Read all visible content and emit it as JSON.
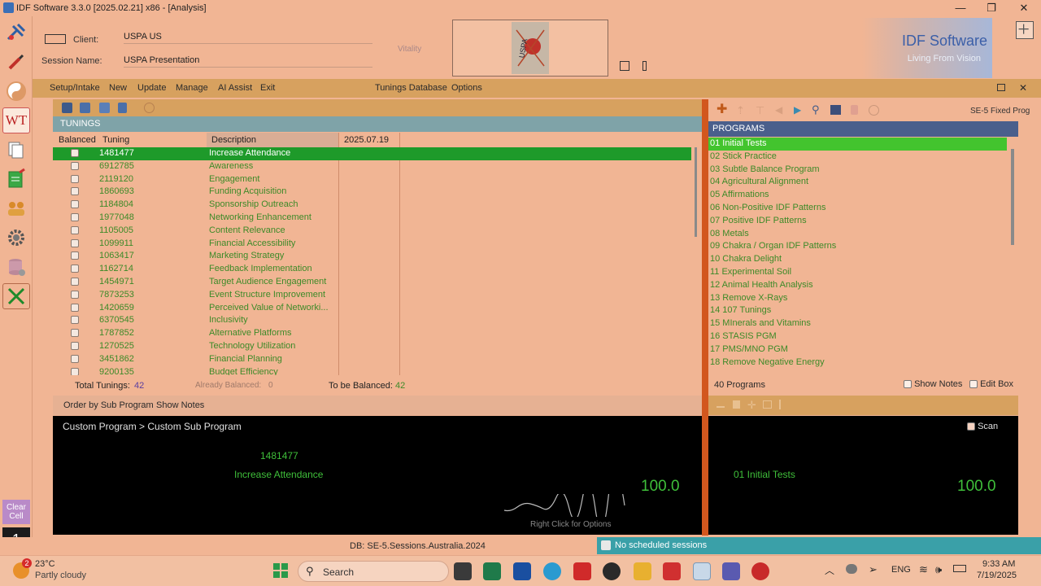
{
  "window": {
    "title": "IDF Software 3.3.0     [2025.02.21]  x86 - [Analysis]",
    "minimize": "—",
    "maximize": "❐",
    "close": "✕"
  },
  "header": {
    "client_label": "Client:",
    "client_value": "USPA US",
    "session_label": "Session Name:",
    "session_value": "USPA Presentation",
    "vitality_label": "Vitality",
    "brand_title": "IDF Software",
    "brand_tagline": "Living From Vision"
  },
  "menu": {
    "setup": "Setup/Intake",
    "new": "New",
    "update": "Update",
    "manage": "Manage",
    "ai_assist": "AI Assist",
    "exit": "Exit",
    "tunings_db": "Tunings Database",
    "options": "Options"
  },
  "tunings": {
    "title": "TUNINGS",
    "col_balanced": "Balanced",
    "col_tuning": "Tuning",
    "col_description": "Description",
    "col_date": "2025.07.19",
    "rows": [
      {
        "tuning": "1481477",
        "description": "Increase Attendance"
      },
      {
        "tuning": "6912785",
        "description": "Awareness"
      },
      {
        "tuning": "2119120",
        "description": "Engagement"
      },
      {
        "tuning": "1860693",
        "description": "Funding Acquisition"
      },
      {
        "tuning": "1184804",
        "description": "Sponsorship Outreach"
      },
      {
        "tuning": "1977048",
        "description": "Networking Enhancement"
      },
      {
        "tuning": "1105005",
        "description": "Content Relevance"
      },
      {
        "tuning": "1099911",
        "description": "Financial Accessibility"
      },
      {
        "tuning": "1063417",
        "description": "Marketing Strategy"
      },
      {
        "tuning": "1162714",
        "description": "Feedback Implementation"
      },
      {
        "tuning": "1454971",
        "description": "Target Audience Engagement"
      },
      {
        "tuning": "7873253",
        "description": "Event Structure Improvement"
      },
      {
        "tuning": "1420659",
        "description": "Perceived Value of Networki..."
      },
      {
        "tuning": "6370545",
        "description": "Inclusivity"
      },
      {
        "tuning": "1787852",
        "description": "Alternative Platforms"
      },
      {
        "tuning": "1270525",
        "description": "Technology Utilization"
      },
      {
        "tuning": "3451862",
        "description": "Financial Planning"
      },
      {
        "tuning": "9200135",
        "description": "Budget Efficiency"
      }
    ],
    "total_label": "Total Tunings:",
    "total_value": "42",
    "already_label": "Already Balanced:",
    "already_value": "0",
    "tobe_label": "To be Balanced:",
    "tobe_value": "42",
    "order_by": "Order by Sub Program",
    "show_notes": "Show Notes"
  },
  "detail": {
    "breadcrumb": "Custom Program > Custom Sub Program",
    "tuning": "1481477",
    "description": "Increase Attendance",
    "value": "100.0",
    "hint": "Right Click for Options"
  },
  "programs": {
    "fixed_label": "SE-5 Fixed Prog",
    "title": "PROGRAMS",
    "items": [
      "01 Initial Tests",
      "02  Stick Practice",
      "03 Subtle Balance Program",
      "04 Agricultural Alignment",
      "05 Affirmations",
      "06 Non-Positive IDF Patterns",
      "07 Positive IDF Patterns",
      "08 Metals",
      "09 Chakra / Organ IDF Patterns",
      "10 Chakra Delight",
      "11 Experimental Soil",
      "12 Animal Health Analysis",
      "13 Remove X-Rays",
      "14 107 Tunings",
      "15 MInerals and Vitamins",
      "16 STASIS PGM",
      "17 PMS/MNO PGM",
      "18 Remove Negative Energy"
    ],
    "count": "40 Programs",
    "show_notes": "Show Notes",
    "edit_box": "Edit Box"
  },
  "right_detail": {
    "scan": "Scan",
    "program": "01 Initial Tests",
    "value": "100.0"
  },
  "left_toolbar": {
    "wt_label": "WT",
    "clear_cell": "Clear Cell",
    "cell_number": "1"
  },
  "status": {
    "db": "DB: SE-5.Sessions.Australia.2024",
    "scheduled": "No scheduled sessions"
  },
  "taskbar": {
    "weather_badge": "2",
    "temperature": "23°C",
    "weather": "Partly cloudy",
    "search": "Search",
    "language": "ENG",
    "time": "9:33 AM",
    "date": "7/19/2025"
  },
  "colors": {
    "background": "#f1b594",
    "menu_bar": "#d7a15f",
    "selected_row": "#1e9a2a",
    "tuning_text": "#3d8a28",
    "programs_header": "#4a5f8c",
    "brand_blue": "#3b5fa8",
    "divider": "#d2571e"
  }
}
